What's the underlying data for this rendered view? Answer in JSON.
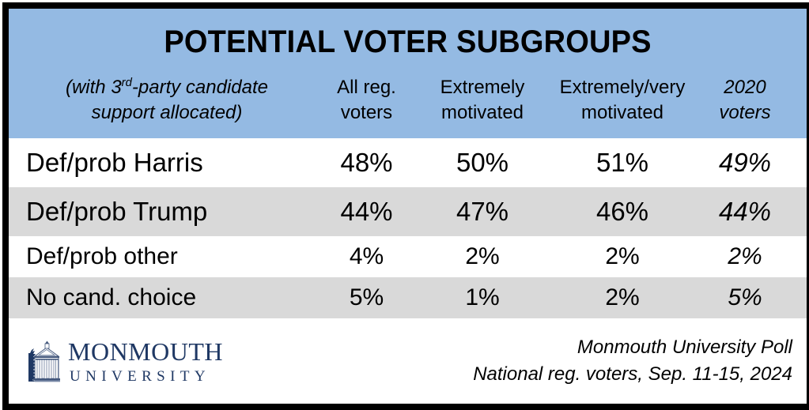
{
  "card": {
    "title": "POTENTIAL VOTER SUBGROUPS",
    "note_line1_pre": "(with 3",
    "note_line1_sup": "rd",
    "note_line1_post": "-party candidate",
    "note_line2": "support allocated)",
    "header_blue": "#94BAE3",
    "shade_gray": "#D9D9D9",
    "border_color": "#000000",
    "logo_navy": "#1F3864"
  },
  "columns": [
    {
      "id": "all-reg-voters",
      "line1": "All reg.",
      "line2": "voters",
      "italic": false
    },
    {
      "id": "extremely-motivated",
      "line1": "Extremely",
      "line2": "motivated",
      "italic": false
    },
    {
      "id": "extremely-very-motivated",
      "line1": "Extremely/very",
      "line2": "motivated",
      "italic": false
    },
    {
      "id": "2020-voters",
      "line1": "2020",
      "line2": "voters",
      "italic": true
    }
  ],
  "rows": [
    {
      "label": "Def/prob Harris",
      "values": [
        "48%",
        "50%",
        "51%",
        "49%"
      ],
      "shaded": false,
      "size": "big"
    },
    {
      "label": "Def/prob Trump",
      "values": [
        "44%",
        "47%",
        "46%",
        "44%"
      ],
      "shaded": true,
      "size": "big"
    },
    {
      "label": "Def/prob other",
      "values": [
        "4%",
        "2%",
        "2%",
        "2%"
      ],
      "shaded": false,
      "size": "small"
    },
    {
      "label": "No cand. choice",
      "values": [
        "5%",
        "1%",
        "2%",
        "5%"
      ],
      "shaded": true,
      "size": "small"
    }
  ],
  "footer": {
    "logo_name": "MONMOUTH",
    "logo_sub": "UNIVERSITY",
    "source_line1": "Monmouth University Poll",
    "source_line2": "National reg. voters, Sep. 11-15, 2024"
  },
  "chart_data": {
    "type": "table",
    "title": "POTENTIAL VOTER SUBGROUPS",
    "subtitle": "(with 3rd-party candidate support allocated)",
    "categories": [
      "All reg. voters",
      "Extremely motivated",
      "Extremely/very motivated",
      "2020 voters"
    ],
    "series": [
      {
        "name": "Def/prob Harris",
        "values": [
          48,
          50,
          51,
          49
        ]
      },
      {
        "name": "Def/prob Trump",
        "values": [
          44,
          47,
          46,
          44
        ]
      },
      {
        "name": "Def/prob other",
        "values": [
          4,
          2,
          2,
          2
        ]
      },
      {
        "name": "No cand. choice",
        "values": [
          5,
          1,
          2,
          5
        ]
      }
    ],
    "units": "percent",
    "source": "Monmouth University Poll — National reg. voters, Sep. 11-15, 2024"
  }
}
